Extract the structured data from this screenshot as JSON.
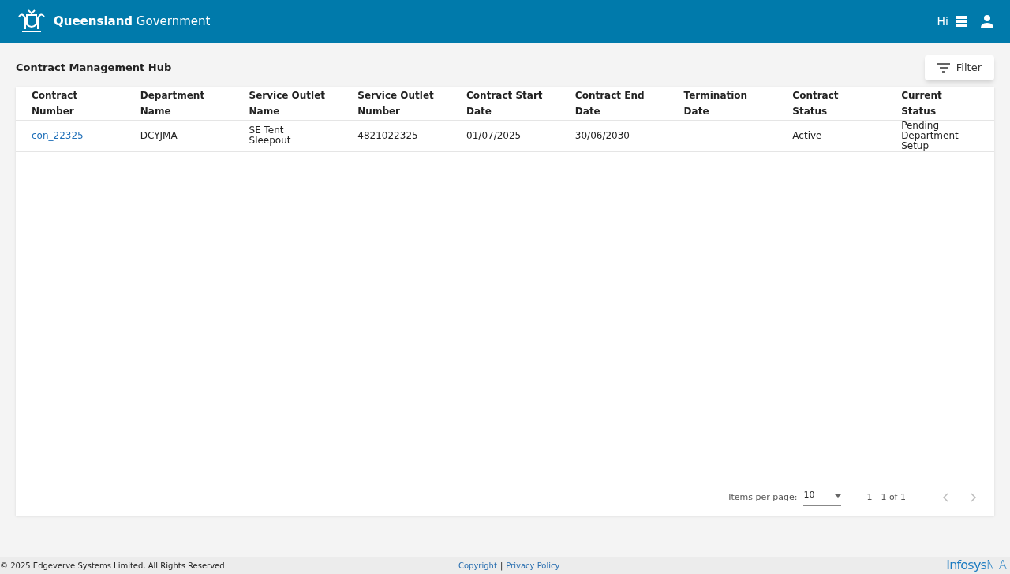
{
  "header": {
    "brand": "**Queensland** Government",
    "greeting": "Hi"
  },
  "page": {
    "title": "Contract Management Hub",
    "filter_button": "Filter"
  },
  "table": {
    "columns": [
      "Contract Number",
      "Department Name",
      "Service Outlet Name",
      "Service Outlet Number",
      "Contract Start Date",
      "Contract End Date",
      "Termination Date",
      "Contract Status",
      "Current Status"
    ],
    "rows": [
      {
        "cells": [
          "con_22325",
          "DCYJMA",
          "SE Tent Sleepout",
          "4821022325",
          "01/07/2025",
          "30/06/2030",
          "",
          "Active",
          "Pending Department Setup"
        ]
      }
    ]
  },
  "paginator": {
    "label": "Items per page:",
    "page_size": "10",
    "range": "1 - 1 of 1",
    "previous_disabled": true,
    "next_disabled": true
  },
  "footer": {
    "copyright": "© 2025 Edgeverve Systems Limited, All Rights Reserved",
    "links": [
      "Copyright",
      "Privacy Policy"
    ],
    "separator": "|",
    "logo_main": "Infosys",
    "logo_sub": "NIA"
  }
}
